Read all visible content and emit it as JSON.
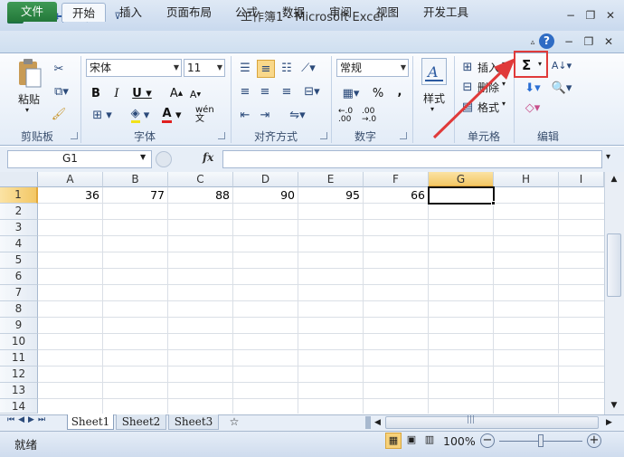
{
  "app": {
    "title": "工作簿1 - Microsoft Excel",
    "icon_letter": "X"
  },
  "tabs": [
    {
      "label": "文件"
    },
    {
      "label": "开始"
    },
    {
      "label": "插入"
    },
    {
      "label": "页面布局"
    },
    {
      "label": "公式"
    },
    {
      "label": "数据"
    },
    {
      "label": "审阅"
    },
    {
      "label": "视图"
    },
    {
      "label": "开发工具"
    }
  ],
  "ribbon": {
    "clipboard": {
      "paste_label": "粘贴",
      "group_label": "剪贴板"
    },
    "font": {
      "name": "宋体",
      "size": "11",
      "group_label": "字体",
      "wen_label": "wén 文"
    },
    "alignment": {
      "group_label": "对齐方式"
    },
    "number": {
      "format": "常规",
      "percent": "%",
      "comma": ",",
      "inc_dec": "←.0 .00",
      "dec_dec": ".00 →.0",
      "group_label": "数字"
    },
    "styles": {
      "label": "样式"
    },
    "cells": {
      "insert_label": "插入",
      "delete_label": "删除",
      "format_label": "格式",
      "group_label": "单元格"
    },
    "editing": {
      "group_label": "编辑",
      "sum_symbol": "Σ"
    }
  },
  "formula_bar": {
    "name_box": "G1",
    "fx_label": "fx",
    "content": ""
  },
  "columns": [
    "A",
    "B",
    "C",
    "D",
    "E",
    "F",
    "G",
    "H",
    "I"
  ],
  "rows": [
    "1",
    "2",
    "3",
    "4",
    "5",
    "6",
    "7",
    "8",
    "9",
    "10",
    "11",
    "12",
    "13",
    "14"
  ],
  "cells": {
    "A1": "36",
    "B1": "77",
    "C1": "88",
    "D1": "90",
    "E1": "95",
    "F1": "66"
  },
  "sheets": [
    "Sheet1",
    "Sheet2",
    "Sheet3"
  ],
  "status": {
    "mode": "就绪",
    "zoom": "100%"
  },
  "colors": {
    "highlight_box": "#e03a3a",
    "arrow": "#e03a3a",
    "file_tab": "#2f8a47",
    "selected_header": "#f7d27a"
  }
}
